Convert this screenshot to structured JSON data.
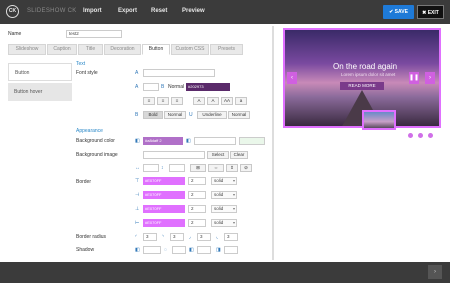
{
  "header": {
    "logo": "CK",
    "app_title": "SLIDESHOW CK",
    "nav": [
      "Import",
      "Export",
      "Reset",
      "Preview"
    ],
    "save_label": "✔ SAVE",
    "exit_label": "✖ EXIT"
  },
  "name_field": {
    "label": "Name",
    "value": "test2"
  },
  "tabs": [
    "Slideshow",
    "Caption",
    "Title",
    "Decoration",
    "Button",
    "Custom CSS",
    "Presets"
  ],
  "active_tab": "Button",
  "sidebar": {
    "items": [
      "Button",
      "Button hover"
    ]
  },
  "text_section": {
    "heading": "Text",
    "font_style_label": "Font style",
    "font_weight": "Normal",
    "text_color": "#202973",
    "style_buttons": [
      "Bold",
      "Normal",
      "Underline",
      "Normal"
    ]
  },
  "appearance": {
    "heading": "Appearance",
    "bg_color_label": "Background color",
    "bg_color_value": "#a8daff 2",
    "bg_image_label": "Background image",
    "select_label": "Select",
    "clear_label": "Clear",
    "border_label": "Border",
    "border_rows": [
      {
        "color": "#E070FF",
        "width": "2",
        "style": "solid"
      },
      {
        "color": "#E070FF",
        "width": "2",
        "style": "solid"
      },
      {
        "color": "#E070FF",
        "width": "2",
        "style": "solid"
      },
      {
        "color": "#E070FF",
        "width": "2",
        "style": "solid"
      }
    ],
    "border_radius_label": "Border radius",
    "radius_values": [
      "3",
      "3",
      "3",
      "3"
    ],
    "shadow_label": "Shadow"
  },
  "preview": {
    "title": "On the road again",
    "subtitle": "Lorem ipsum dolor sit amet",
    "button": "READ MORE"
  },
  "colors": {
    "accent": "#1e7ad8",
    "highlight": "#e070ff",
    "topbar": "#3b3b3b"
  }
}
